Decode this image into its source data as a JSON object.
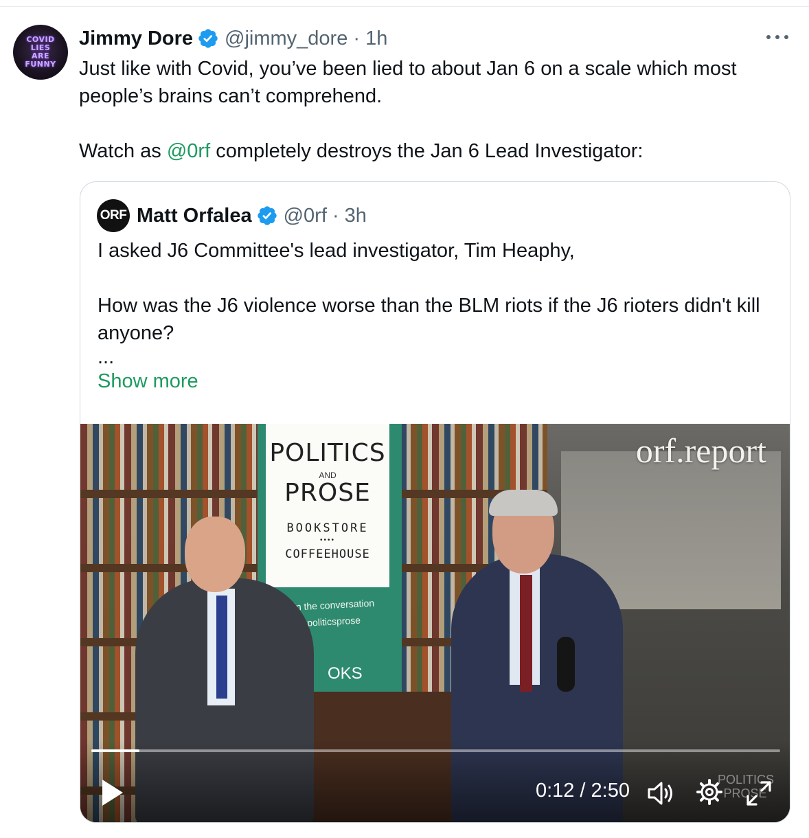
{
  "tweet": {
    "author": {
      "display_name": "Jimmy Dore",
      "verified": true,
      "handle": "@jimmy_dore",
      "time": "· 1h",
      "avatar_text": [
        "COVID",
        "LIES",
        "ARE",
        "FUNNY"
      ]
    },
    "text_line1": "Just like with Covid, you’ve been lied to about Jan 6 on a scale which most people’s brains can’t comprehend.",
    "text_line2_prefix": "Watch as ",
    "text_line2_mention": "@0rf",
    "text_line2_suffix": "  completely destroys the Jan 6 Lead Investigator:"
  },
  "quote": {
    "author": {
      "avatar_text": "ORF",
      "display_name": "Matt Orfalea",
      "verified": true,
      "handle": "@0rf",
      "time": "· 3h"
    },
    "paragraph1": "I asked J6 Committee's lead investigator, Tim Heaphy,",
    "paragraph2": "How was the J6 violence worse than the BLM riots if the J6 rioters didn't kill anyone?",
    "ellipsis": "...",
    "show_more": "Show more"
  },
  "video": {
    "watermark": "orf.report",
    "banner": {
      "line1": "POLITICS",
      "and": "AND",
      "line2": "PROSE",
      "bookstore": "BOOKSTORE",
      "dots": "••••",
      "coffeehouse": "COFFEEHOUSE",
      "join": "Join the conversation",
      "handle": "@politicsprose",
      "oks": "OKS"
    },
    "corner_mark_line1": "POLITICS",
    "corner_mark_line2": "PROSE",
    "time_display": "0:12 / 2:50",
    "progress": 0.07
  },
  "colors": {
    "accent_link": "#1d9b5f",
    "verified_blue": "#1d9bf0",
    "secondary_text": "#536471"
  },
  "icons": {
    "verified": "verified-badge-icon",
    "more": "more-options-icon",
    "play": "play-icon",
    "volume": "volume-icon",
    "settings": "gear-icon",
    "fullscreen": "expand-icon"
  }
}
